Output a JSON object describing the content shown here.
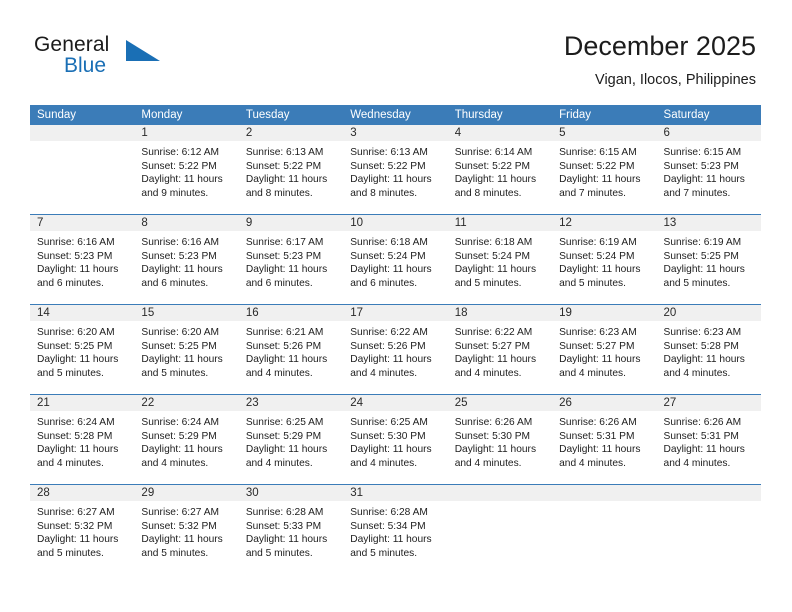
{
  "brand": {
    "name_part1": "General",
    "name_part2": "Blue",
    "flag_icon": "blue-triangle-flag-icon",
    "accent_color": "#1a6fb5"
  },
  "header": {
    "title": "December 2025",
    "subtitle": "Vigan, Ilocos, Philippines"
  },
  "calendar": {
    "header_bg": "#3b7cb8",
    "date_band_bg": "#f0f0f0",
    "weekdays": [
      "Sunday",
      "Monday",
      "Tuesday",
      "Wednesday",
      "Thursday",
      "Friday",
      "Saturday"
    ],
    "weeks": [
      {
        "days": [
          {
            "date": "",
            "lines": []
          },
          {
            "date": "1",
            "lines": [
              "Sunrise: 6:12 AM",
              "Sunset: 5:22 PM",
              "Daylight: 11 hours",
              "and 9 minutes."
            ]
          },
          {
            "date": "2",
            "lines": [
              "Sunrise: 6:13 AM",
              "Sunset: 5:22 PM",
              "Daylight: 11 hours",
              "and 8 minutes."
            ]
          },
          {
            "date": "3",
            "lines": [
              "Sunrise: 6:13 AM",
              "Sunset: 5:22 PM",
              "Daylight: 11 hours",
              "and 8 minutes."
            ]
          },
          {
            "date": "4",
            "lines": [
              "Sunrise: 6:14 AM",
              "Sunset: 5:22 PM",
              "Daylight: 11 hours",
              "and 8 minutes."
            ]
          },
          {
            "date": "5",
            "lines": [
              "Sunrise: 6:15 AM",
              "Sunset: 5:22 PM",
              "Daylight: 11 hours",
              "and 7 minutes."
            ]
          },
          {
            "date": "6",
            "lines": [
              "Sunrise: 6:15 AM",
              "Sunset: 5:23 PM",
              "Daylight: 11 hours",
              "and 7 minutes."
            ]
          }
        ]
      },
      {
        "days": [
          {
            "date": "7",
            "lines": [
              "Sunrise: 6:16 AM",
              "Sunset: 5:23 PM",
              "Daylight: 11 hours",
              "and 6 minutes."
            ]
          },
          {
            "date": "8",
            "lines": [
              "Sunrise: 6:16 AM",
              "Sunset: 5:23 PM",
              "Daylight: 11 hours",
              "and 6 minutes."
            ]
          },
          {
            "date": "9",
            "lines": [
              "Sunrise: 6:17 AM",
              "Sunset: 5:23 PM",
              "Daylight: 11 hours",
              "and 6 minutes."
            ]
          },
          {
            "date": "10",
            "lines": [
              "Sunrise: 6:18 AM",
              "Sunset: 5:24 PM",
              "Daylight: 11 hours",
              "and 6 minutes."
            ]
          },
          {
            "date": "11",
            "lines": [
              "Sunrise: 6:18 AM",
              "Sunset: 5:24 PM",
              "Daylight: 11 hours",
              "and 5 minutes."
            ]
          },
          {
            "date": "12",
            "lines": [
              "Sunrise: 6:19 AM",
              "Sunset: 5:24 PM",
              "Daylight: 11 hours",
              "and 5 minutes."
            ]
          },
          {
            "date": "13",
            "lines": [
              "Sunrise: 6:19 AM",
              "Sunset: 5:25 PM",
              "Daylight: 11 hours",
              "and 5 minutes."
            ]
          }
        ]
      },
      {
        "days": [
          {
            "date": "14",
            "lines": [
              "Sunrise: 6:20 AM",
              "Sunset: 5:25 PM",
              "Daylight: 11 hours",
              "and 5 minutes."
            ]
          },
          {
            "date": "15",
            "lines": [
              "Sunrise: 6:20 AM",
              "Sunset: 5:25 PM",
              "Daylight: 11 hours",
              "and 5 minutes."
            ]
          },
          {
            "date": "16",
            "lines": [
              "Sunrise: 6:21 AM",
              "Sunset: 5:26 PM",
              "Daylight: 11 hours",
              "and 4 minutes."
            ]
          },
          {
            "date": "17",
            "lines": [
              "Sunrise: 6:22 AM",
              "Sunset: 5:26 PM",
              "Daylight: 11 hours",
              "and 4 minutes."
            ]
          },
          {
            "date": "18",
            "lines": [
              "Sunrise: 6:22 AM",
              "Sunset: 5:27 PM",
              "Daylight: 11 hours",
              "and 4 minutes."
            ]
          },
          {
            "date": "19",
            "lines": [
              "Sunrise: 6:23 AM",
              "Sunset: 5:27 PM",
              "Daylight: 11 hours",
              "and 4 minutes."
            ]
          },
          {
            "date": "20",
            "lines": [
              "Sunrise: 6:23 AM",
              "Sunset: 5:28 PM",
              "Daylight: 11 hours",
              "and 4 minutes."
            ]
          }
        ]
      },
      {
        "days": [
          {
            "date": "21",
            "lines": [
              "Sunrise: 6:24 AM",
              "Sunset: 5:28 PM",
              "Daylight: 11 hours",
              "and 4 minutes."
            ]
          },
          {
            "date": "22",
            "lines": [
              "Sunrise: 6:24 AM",
              "Sunset: 5:29 PM",
              "Daylight: 11 hours",
              "and 4 minutes."
            ]
          },
          {
            "date": "23",
            "lines": [
              "Sunrise: 6:25 AM",
              "Sunset: 5:29 PM",
              "Daylight: 11 hours",
              "and 4 minutes."
            ]
          },
          {
            "date": "24",
            "lines": [
              "Sunrise: 6:25 AM",
              "Sunset: 5:30 PM",
              "Daylight: 11 hours",
              "and 4 minutes."
            ]
          },
          {
            "date": "25",
            "lines": [
              "Sunrise: 6:26 AM",
              "Sunset: 5:30 PM",
              "Daylight: 11 hours",
              "and 4 minutes."
            ]
          },
          {
            "date": "26",
            "lines": [
              "Sunrise: 6:26 AM",
              "Sunset: 5:31 PM",
              "Daylight: 11 hours",
              "and 4 minutes."
            ]
          },
          {
            "date": "27",
            "lines": [
              "Sunrise: 6:26 AM",
              "Sunset: 5:31 PM",
              "Daylight: 11 hours",
              "and 4 minutes."
            ]
          }
        ]
      },
      {
        "days": [
          {
            "date": "28",
            "lines": [
              "Sunrise: 6:27 AM",
              "Sunset: 5:32 PM",
              "Daylight: 11 hours",
              "and 5 minutes."
            ]
          },
          {
            "date": "29",
            "lines": [
              "Sunrise: 6:27 AM",
              "Sunset: 5:32 PM",
              "Daylight: 11 hours",
              "and 5 minutes."
            ]
          },
          {
            "date": "30",
            "lines": [
              "Sunrise: 6:28 AM",
              "Sunset: 5:33 PM",
              "Daylight: 11 hours",
              "and 5 minutes."
            ]
          },
          {
            "date": "31",
            "lines": [
              "Sunrise: 6:28 AM",
              "Sunset: 5:34 PM",
              "Daylight: 11 hours",
              "and 5 minutes."
            ]
          },
          {
            "date": "",
            "lines": []
          },
          {
            "date": "",
            "lines": []
          },
          {
            "date": "",
            "lines": []
          }
        ]
      }
    ]
  }
}
